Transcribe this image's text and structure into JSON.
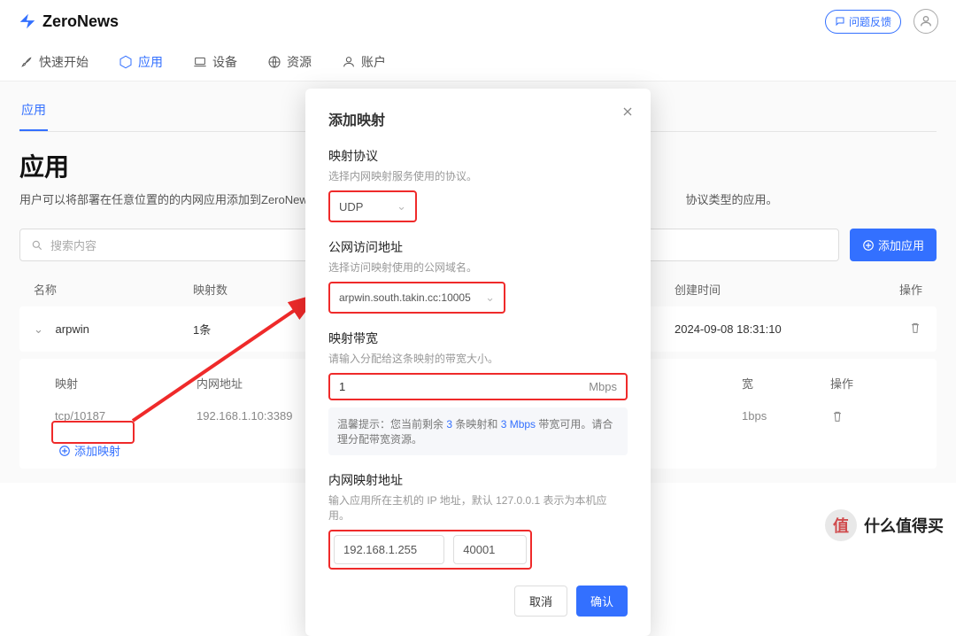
{
  "brand": "ZeroNews",
  "header": {
    "feedback": "问题反馈"
  },
  "nav": {
    "quickstart": "快速开始",
    "apps": "应用",
    "devices": "设备",
    "resources": "资源",
    "account": "账户"
  },
  "tabs": {
    "current": "应用"
  },
  "page_title": "应用",
  "page_desc_prefix": "用户可以将部署在任意位置的的内网应用添加到ZeroNews平",
  "page_desc_suffix": "协议类型的应用。",
  "search_placeholder": "搜索内容",
  "add_app_btn": "添加应用",
  "table": {
    "headers": {
      "name": "名称",
      "count": "映射数",
      "created": "创建时间",
      "action": "操作"
    },
    "row": {
      "name": "arpwin",
      "count": "1条",
      "created": "2024-09-08 18:31:10"
    },
    "sub": {
      "headers": {
        "map": "映射",
        "intranet": "内网地址",
        "bw": "宽",
        "action": "操作"
      },
      "row": {
        "map": "tcp/10187",
        "intranet": "192.168.1.10:3389",
        "bw": "1bps"
      },
      "add_link": "添加映射"
    }
  },
  "modal": {
    "title": "添加映射",
    "proto": {
      "label": "映射协议",
      "hint": "选择内网映射服务使用的协议。",
      "value": "UDP"
    },
    "pub": {
      "label": "公网访问地址",
      "hint": "选择访问映射使用的公网域名。",
      "value": "arpwin.south.takin.cc:10005"
    },
    "bw": {
      "label": "映射带宽",
      "hint": "请输入分配给这条映射的带宽大小。",
      "value": "1",
      "unit": "Mbps",
      "tip_a": "温馨提示：您当前剩余 ",
      "tip_n1": "3",
      "tip_b": " 条映射和 ",
      "tip_n2": "3 Mbps",
      "tip_c": " 带宽可用。请合理分配带宽资源。"
    },
    "addr": {
      "label": "内网映射地址",
      "hint": "输入应用所在主机的 IP 地址，默认 127.0.0.1 表示为本机应用。",
      "ip": "192.168.1.255",
      "port": "40001"
    },
    "cancel": "取消",
    "ok": "确认"
  },
  "watermark": "什么值得买"
}
